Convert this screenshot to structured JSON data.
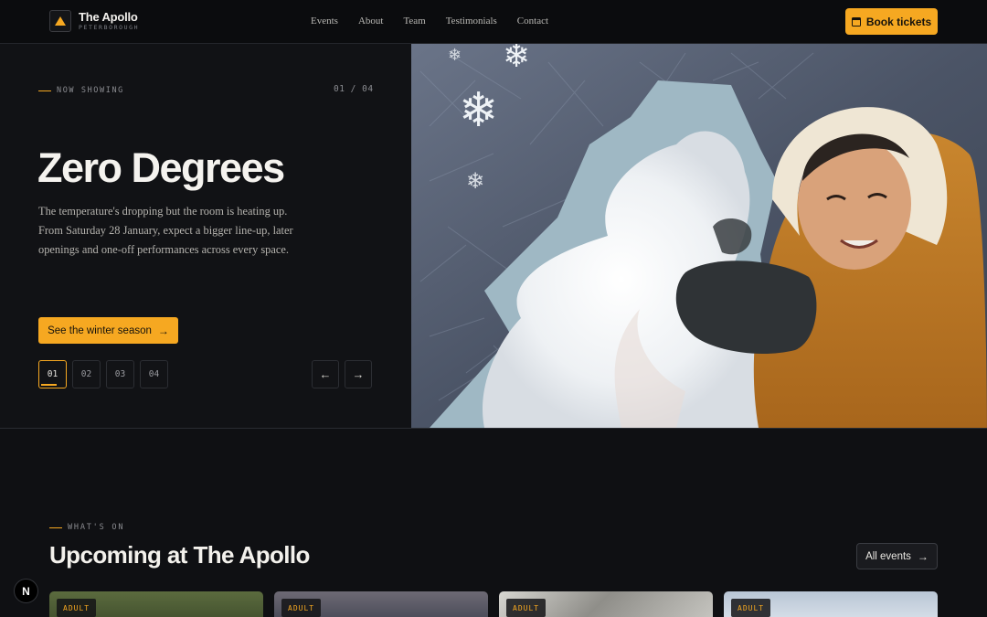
{
  "brand": {
    "name": "The Apollo",
    "subtitle": "PETERBOROUGH",
    "logo_icon": "triangle-icon"
  },
  "nav": {
    "links": [
      "Events",
      "About",
      "Team",
      "Testimonials",
      "Contact"
    ],
    "book_label": "Book tickets",
    "book_icon": "calendar-icon"
  },
  "hero": {
    "eyebrow": "NOW SHOWING",
    "counter": "01 / 04",
    "title": "Zero Degrees",
    "description": "The temperature's dropping but the room is heating up. From Saturday 28 January, expect a bigger line-up, later openings and one-off performances across every space.",
    "cta_label": "See the winter season",
    "slides": [
      "01",
      "02",
      "03",
      "04"
    ],
    "active_slide": "01"
  },
  "whats_on": {
    "eyebrow": "WHAT'S ON",
    "title": "Upcoming at The Apollo",
    "all_events_label": "All events",
    "cards": [
      {
        "badge": "ADULT"
      },
      {
        "badge": "ADULT"
      },
      {
        "badge": "ADULT"
      },
      {
        "badge": "ADULT"
      }
    ]
  },
  "colors": {
    "accent": "#f6a821",
    "background": "#0f1013"
  },
  "fab_label": "N"
}
